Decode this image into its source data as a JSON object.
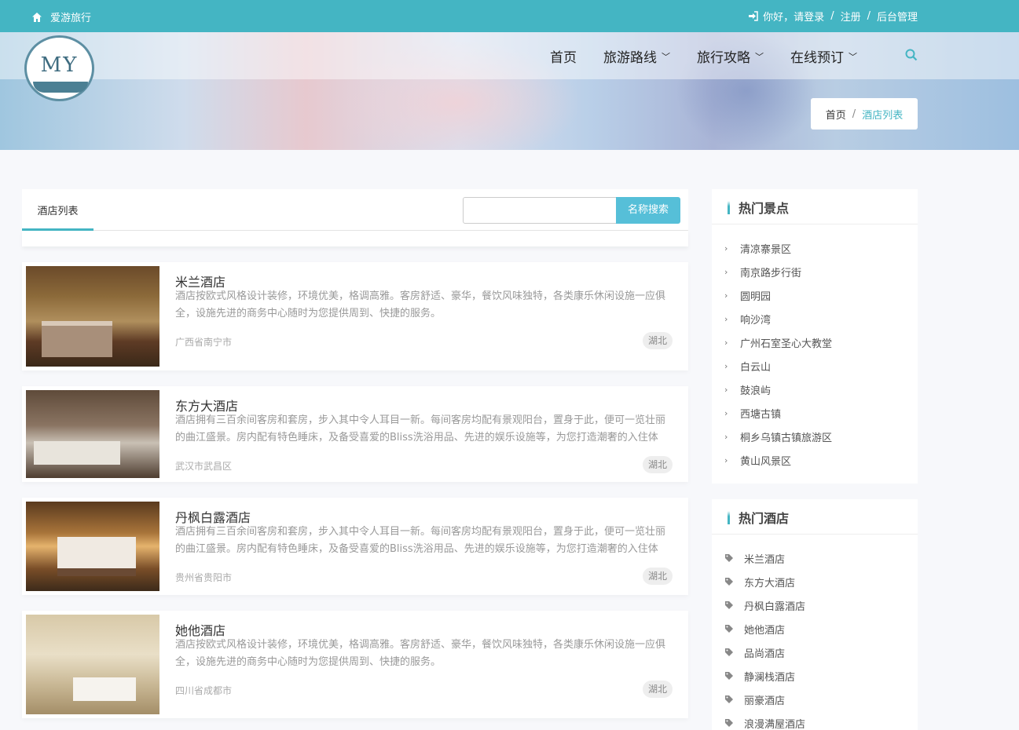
{
  "topbar": {
    "brand": "爱游旅行",
    "greeting": "你好，请登录",
    "register": "注册",
    "admin": "后台管理",
    "sep1": "/",
    "sep2": "/"
  },
  "logo": {
    "text": "MY"
  },
  "nav": {
    "home": "首页",
    "routes": "旅游路线",
    "guides": "旅行攻略",
    "booking": "在线预订"
  },
  "breadcrumb": {
    "home": "首页",
    "sep": "/",
    "current": "酒店列表"
  },
  "list": {
    "tab": "酒店列表",
    "search_button": "名称搜索",
    "search_placeholder": "",
    "hotels": [
      {
        "name": "米兰酒店",
        "desc": "酒店按欧式风格设计装修，环境优美，格调高雅。客房舒适、豪华，餐饮风味独特，各类康乐休闲设施一应俱全，设施先进的商务中心随时为您提供周到、快捷的服务。",
        "location": "广西省南宁市",
        "tag": "湖北"
      },
      {
        "name": "东方大酒店",
        "desc": "酒店拥有三百余间客房和套房，步入其中令人耳目一新。每间客房均配有景观阳台，置身于此，便可一览壮丽的曲江盛景。房内配有特色睡床，及备受喜爱的Bliss洗浴用品、先进的娱乐设施等，为您打造潮奢的入住体",
        "location": "武汉市武昌区",
        "tag": "湖北"
      },
      {
        "name": "丹枫白露酒店",
        "desc": "酒店拥有三百余间客房和套房，步入其中令人耳目一新。每间客房均配有景观阳台，置身于此，便可一览壮丽的曲江盛景。房内配有特色睡床，及备受喜爱的Bliss洗浴用品、先进的娱乐设施等，为您打造潮奢的入住体",
        "location": "贵州省贵阳市",
        "tag": "湖北"
      },
      {
        "name": "她他酒店",
        "desc": "酒店按欧式风格设计装修，环境优美，格调高雅。客房舒适、豪华，餐饮风味独特，各类康乐休闲设施一应俱全，设施先进的商务中心随时为您提供周到、快捷的服务。",
        "location": "四川省成都市",
        "tag": "湖北"
      }
    ]
  },
  "sidebar": {
    "hot_spots": {
      "title": "热门景点",
      "items": [
        "清凉寨景区",
        "南京路步行街",
        "圆明园",
        "响沙湾",
        "广州石室圣心大教堂",
        "白云山",
        "鼓浪屿",
        "西塘古镇",
        "桐乡乌镇古镇旅游区",
        "黄山风景区"
      ]
    },
    "hot_hotels": {
      "title": "热门酒店",
      "items": [
        "米兰酒店",
        "东方大酒店",
        "丹枫白露酒店",
        "她他酒店",
        "品尚酒店",
        "静澜栈酒店",
        "丽豪酒店",
        "浪漫满屋酒店"
      ]
    }
  },
  "colors": {
    "accent": "#44b5c3",
    "search_button": "#56bfd8"
  }
}
